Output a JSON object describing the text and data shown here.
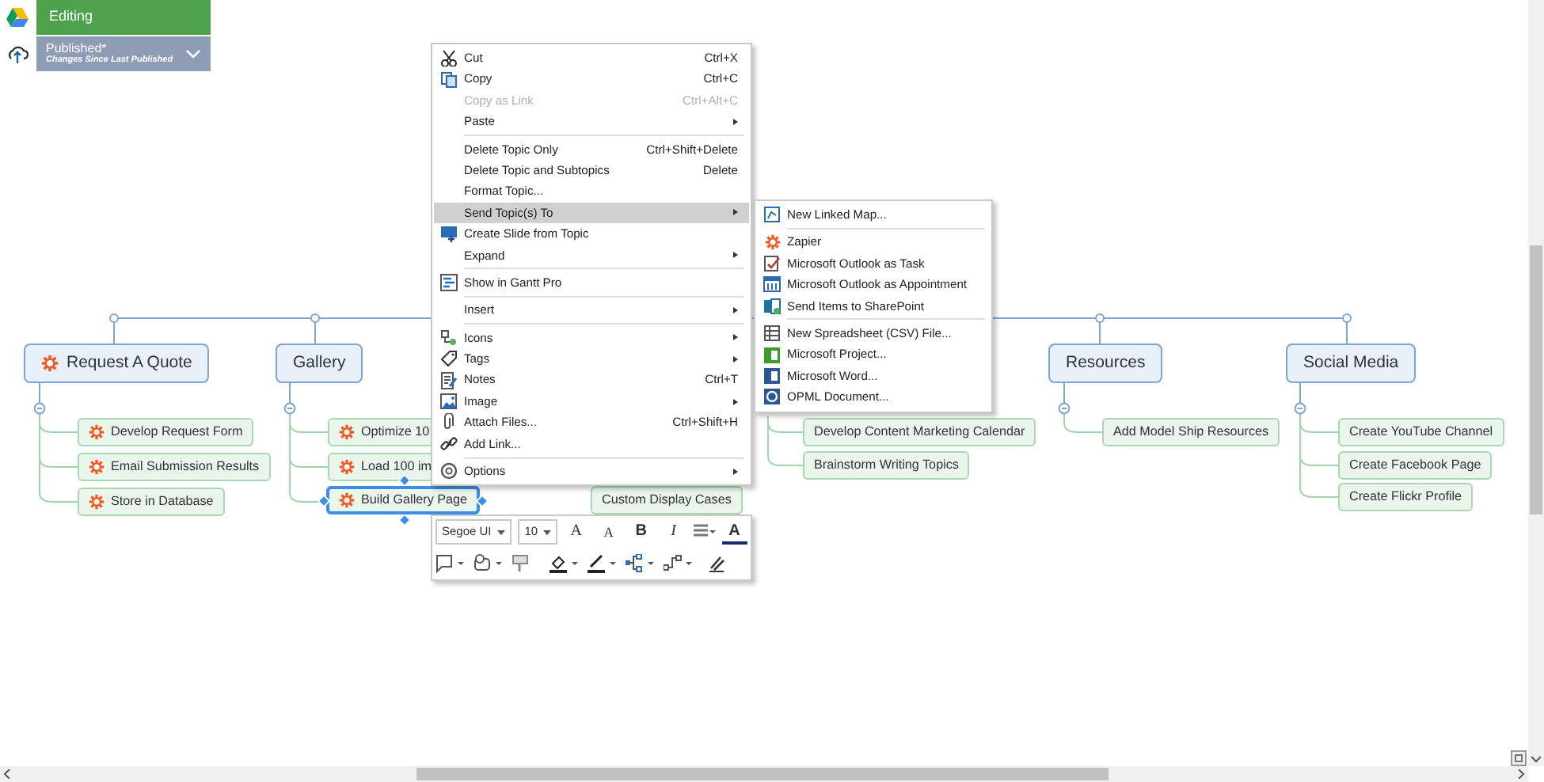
{
  "header": {
    "status": "Editing",
    "publish": {
      "title": "Published*",
      "subtitle": "Changes Since Last Published"
    }
  },
  "map": {
    "topics": [
      {
        "label": "Request A Quote",
        "icon": true,
        "children": [
          {
            "label": "Develop Request Form",
            "icon": true,
            "selected": false
          },
          {
            "label": "Email Submission Results",
            "icon": true,
            "selected": false
          },
          {
            "label": "Store in Database",
            "icon": true,
            "selected": false
          }
        ]
      },
      {
        "label": "Gallery",
        "icon": false,
        "children": [
          {
            "label": "Optimize 10",
            "icon": true,
            "selected": false
          },
          {
            "label": "Load 100 im",
            "icon": true,
            "selected": false
          },
          {
            "label": "Build Gallery Page",
            "icon": true,
            "selected": true
          }
        ]
      },
      {
        "children": [
          {
            "label": "Custom Display Cases",
            "icon": false,
            "selected": false
          }
        ]
      },
      {
        "children": [
          {
            "label": "Develop Content Marketing Calendar",
            "icon": false,
            "selected": false
          },
          {
            "label": "Brainstorm Writing Topics",
            "icon": false,
            "selected": false
          }
        ]
      },
      {
        "label": "Resources",
        "icon": false,
        "children": [
          {
            "label": "Add Model Ship Resources",
            "icon": false,
            "selected": false
          }
        ]
      },
      {
        "label": "Social Media",
        "icon": false,
        "children": [
          {
            "label": "Create YouTube Channel",
            "icon": false,
            "selected": false
          },
          {
            "label": "Create Facebook Page",
            "icon": false,
            "selected": false
          },
          {
            "label": "Create Flickr Profile",
            "icon": false,
            "selected": false
          }
        ]
      }
    ]
  },
  "context_menu": {
    "items": [
      {
        "kind": "item",
        "label": "Cut",
        "shortcut": "Ctrl+X",
        "submenu": false,
        "disabled": false,
        "selected": false
      },
      {
        "kind": "item",
        "label": "Copy",
        "shortcut": "Ctrl+C",
        "submenu": false,
        "disabled": false,
        "selected": false
      },
      {
        "kind": "item",
        "label": "Copy as Link",
        "shortcut": "Ctrl+Alt+C",
        "submenu": false,
        "disabled": true,
        "selected": false
      },
      {
        "kind": "item",
        "label": "Paste",
        "submenu": true,
        "disabled": false,
        "selected": false
      },
      {
        "kind": "separator"
      },
      {
        "kind": "item",
        "label": "Delete Topic Only",
        "shortcut": "Ctrl+Shift+Delete",
        "submenu": false,
        "disabled": false,
        "selected": false
      },
      {
        "kind": "item",
        "label": "Delete Topic and Subtopics",
        "shortcut": "Delete",
        "submenu": false,
        "disabled": false,
        "selected": false
      },
      {
        "kind": "item",
        "label": "Format Topic...",
        "submenu": false,
        "disabled": false,
        "selected": false
      },
      {
        "kind": "item",
        "label": "Send Topic(s) To",
        "submenu": true,
        "disabled": false,
        "selected": true
      },
      {
        "kind": "item",
        "label": "Create Slide from Topic",
        "submenu": false,
        "disabled": false,
        "selected": false
      },
      {
        "kind": "item",
        "label": "Expand",
        "submenu": true,
        "disabled": false,
        "selected": false
      },
      {
        "kind": "separator"
      },
      {
        "kind": "item",
        "label": "Show in Gantt Pro",
        "submenu": false,
        "disabled": false,
        "selected": false
      },
      {
        "kind": "separator"
      },
      {
        "kind": "item",
        "label": "Insert",
        "submenu": true,
        "disabled": false,
        "selected": false
      },
      {
        "kind": "separator"
      },
      {
        "kind": "item",
        "label": "Icons",
        "submenu": true,
        "disabled": false,
        "selected": false
      },
      {
        "kind": "item",
        "label": "Tags",
        "submenu": true,
        "disabled": false,
        "selected": false
      },
      {
        "kind": "item",
        "label": "Notes",
        "shortcut": "Ctrl+T",
        "submenu": false,
        "disabled": false,
        "selected": false
      },
      {
        "kind": "item",
        "label": "Image",
        "submenu": true,
        "disabled": false,
        "selected": false
      },
      {
        "kind": "item",
        "label": "Attach Files...",
        "shortcut": "Ctrl+Shift+H",
        "submenu": false,
        "disabled": false,
        "selected": false
      },
      {
        "kind": "item",
        "label": "Add Link...",
        "submenu": false,
        "disabled": false,
        "selected": false
      },
      {
        "kind": "separator"
      },
      {
        "kind": "item",
        "label": "Options",
        "submenu": true,
        "disabled": false,
        "selected": false
      }
    ]
  },
  "submenu": {
    "items": [
      {
        "kind": "item",
        "label": "New Linked Map..."
      },
      {
        "kind": "separator"
      },
      {
        "kind": "item",
        "label": "Zapier"
      },
      {
        "kind": "item",
        "label": "Microsoft Outlook as Task"
      },
      {
        "kind": "item",
        "label": "Microsoft Outlook as Appointment"
      },
      {
        "kind": "item",
        "label": "Send Items to SharePoint"
      },
      {
        "kind": "separator"
      },
      {
        "kind": "item",
        "label": "New Spreadsheet (CSV) File..."
      },
      {
        "kind": "item",
        "label": "Microsoft Project..."
      },
      {
        "kind": "item",
        "label": "Microsoft Word..."
      },
      {
        "kind": "item",
        "label": "OPML Document..."
      }
    ]
  },
  "format_toolbar": {
    "font": "Segoe UI",
    "size": "10",
    "text_buttons": [
      "A",
      "A",
      "B",
      "I"
    ],
    "font_color": "A"
  }
}
